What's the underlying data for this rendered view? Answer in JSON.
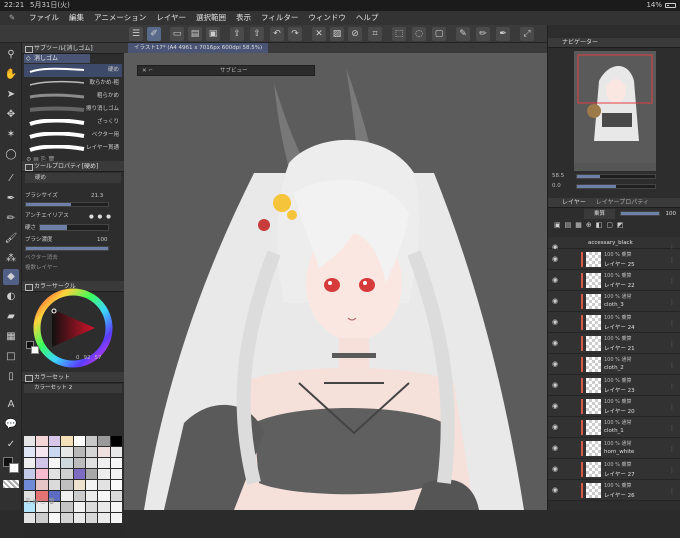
{
  "status": {
    "time": "22:21",
    "date": "5月31日(火)",
    "battery": "14%"
  },
  "menu": [
    "ファイル",
    "編集",
    "アニメーション",
    "レイヤー",
    "選択範囲",
    "表示",
    "フィルター",
    "ウィンドウ",
    "ヘルプ"
  ],
  "canvas": {
    "tab_title": "イラスト17* (A4 4961 x 7016px 600dpi 58.5%)",
    "subview_title": "サブビュー"
  },
  "subtool": {
    "header": "サブツール[消しゴム]",
    "group": "消しゴム",
    "items": [
      {
        "label": "硬め",
        "selected": true
      },
      {
        "label": "軟らかめ-粗"
      },
      {
        "label": "粗らかめ"
      },
      {
        "label": "擦り消しゴム"
      },
      {
        "label": "ざっくり"
      },
      {
        "label": "ベクター用"
      },
      {
        "label": "レイヤー貫通"
      }
    ]
  },
  "tool_property": {
    "header": "ツールプロパティ[硬め]",
    "tool_name": "硬め",
    "brush_size_label": "ブラシサイズ",
    "brush_size_value": "21.3",
    "antialias_label": "アンチエイリアス",
    "hardness_label": "硬さ",
    "density_label": "ブラシ濃度",
    "density_value": "100",
    "vector_erase_label": "ベクター消去",
    "all_layers_label": "複数レイヤー"
  },
  "color_circle": {
    "header": "カラーサークル",
    "hsv": {
      "h": "0",
      "s": "92",
      "v": "57"
    }
  },
  "color_set": {
    "header": "カラーセット",
    "name": "カラーセット 2",
    "swatches": [
      "#e6e6e6",
      "#f4d6d6",
      "#d7c6e9",
      "#f3e0b9",
      "#ffffff",
      "#c8c8c8",
      "#9a9a9a",
      "#000000",
      "#dfe6f5",
      "#f5e6f0",
      "#c9d7f0",
      "#e7e7e7",
      "#b8b8b8",
      "#d6d6d6",
      "#f0e0e0",
      "#e8e8e8",
      "#eeeeee",
      "#d1c4e9",
      "#f5f5f5",
      "#cfd8dc",
      "#bcbcbc",
      "#e0e0e0",
      "#efefef",
      "#f7f7f7",
      "#c5cae9",
      "#f8bbd0",
      "#e1e1e1",
      "#d0d0d0",
      "#7e6bc2",
      "#a8a8a8",
      "#ededed",
      "#f2f2f2",
      "#6f8ad6",
      "#e6c6c6",
      "#dadada",
      "#c0c0c0",
      "#efe3d0",
      "#f3f3f3",
      "#e2e2e2",
      "#fafafa",
      "#dedede",
      "#e57373",
      "#5c6bc0",
      "#f0f0f0",
      "#cccccc",
      "#ebebeb",
      "#f6f6f6",
      "#d9d9d9",
      "#b3e5fc",
      "#ececec",
      "#e4e4e4",
      "#c4c4c4",
      "#f1f1f1",
      "#dcdcdc",
      "#e9e9e9",
      "#f4f4f4",
      "#e3e3e3",
      "#cdcdcd",
      "#f9f9f9",
      "#d3d3d3",
      "#e8e8e8",
      "#d8d8d8",
      "#eaeaea",
      "#f5f5f5"
    ]
  },
  "navigator": {
    "header": "ナビゲーター",
    "zoom": "58.5",
    "angle": "0.0"
  },
  "layers": {
    "header": "レイヤー",
    "prop_tab": "レイヤープロパティ",
    "blend": "乗算",
    "opacity": "100",
    "items": [
      {
        "kind": "folder",
        "name": "accessary_black"
      },
      {
        "kind": "layer",
        "mode": "100 % 乗算",
        "name": "レイヤー 25"
      },
      {
        "kind": "layer",
        "mode": "100 % 乗算",
        "name": "レイヤー 22"
      },
      {
        "kind": "layer",
        "mode": "100 % 通常",
        "name": "cloth_3"
      },
      {
        "kind": "layer",
        "mode": "100 % 乗算",
        "name": "レイヤー 24"
      },
      {
        "kind": "layer",
        "mode": "100 % 乗算",
        "name": "レイヤー 21"
      },
      {
        "kind": "layer",
        "mode": "100 % 通常",
        "name": "cloth_2"
      },
      {
        "kind": "layer",
        "mode": "100 % 乗算",
        "name": "レイヤー 23"
      },
      {
        "kind": "layer",
        "mode": "100 % 乗算",
        "name": "レイヤー 20"
      },
      {
        "kind": "layer",
        "mode": "100 % 通常",
        "name": "cloth_1"
      },
      {
        "kind": "layer",
        "mode": "100 % 通常",
        "name": "horn_white"
      },
      {
        "kind": "layer",
        "mode": "100 % 乗算",
        "name": "レイヤー 27"
      },
      {
        "kind": "layer",
        "mode": "100 % 乗算",
        "name": "レイヤー 26"
      }
    ]
  }
}
